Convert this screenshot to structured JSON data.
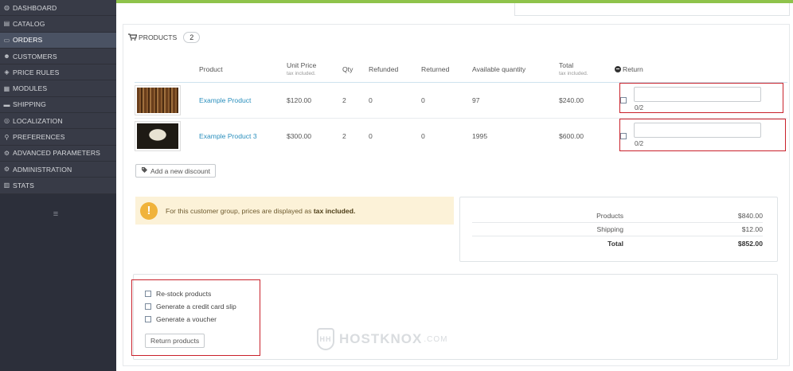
{
  "sidebar": {
    "items": [
      {
        "icon": "dashboard-icon",
        "glyph": "◍",
        "label": "DASHBOARD"
      },
      {
        "icon": "catalog-icon",
        "glyph": "▤",
        "label": "CATALOG"
      },
      {
        "icon": "orders-icon",
        "glyph": "▭",
        "label": "ORDERS"
      },
      {
        "icon": "customers-icon",
        "glyph": "☻",
        "label": "CUSTOMERS"
      },
      {
        "icon": "price-rules-icon",
        "glyph": "◈",
        "label": "PRICE RULES"
      },
      {
        "icon": "modules-icon",
        "glyph": "▦",
        "label": "MODULES"
      },
      {
        "icon": "shipping-icon",
        "glyph": "▬",
        "label": "SHIPPING"
      },
      {
        "icon": "localization-icon",
        "glyph": "◎",
        "label": "LOCALIZATION"
      },
      {
        "icon": "preferences-icon",
        "glyph": "⚲",
        "label": "PREFERENCES"
      },
      {
        "icon": "advanced-parameters-icon",
        "glyph": "⚙",
        "label": "ADVANCED PARAMETERS"
      },
      {
        "icon": "administration-icon",
        "glyph": "⚙",
        "label": "ADMINISTRATION"
      },
      {
        "icon": "stats-icon",
        "glyph": "▥",
        "label": "STATS"
      }
    ],
    "active_item": "ORDERS",
    "collapse_glyph": "≡"
  },
  "products_panel": {
    "title": "PRODUCTS",
    "count": "2",
    "columns": {
      "product": "Product",
      "unit_price": "Unit Price",
      "unit_price_sub": "tax included.",
      "qty": "Qty",
      "refunded": "Refunded",
      "returned": "Returned",
      "available": "Available quantity",
      "total": "Total",
      "total_sub": "tax included.",
      "return": "Return"
    },
    "rows": [
      {
        "name": "Example Product",
        "unit_price": "$120.00",
        "qty": "2",
        "refunded": "0",
        "returned": "0",
        "available": "97",
        "total": "$240.00",
        "return_count": "0/2",
        "return_value": ""
      },
      {
        "name": "Example Product 3",
        "unit_price": "$300.00",
        "qty": "2",
        "refunded": "0",
        "returned": "0",
        "available": "1995",
        "total": "$600.00",
        "return_count": "0/2",
        "return_value": ""
      }
    ],
    "add_discount_label": "Add a new discount"
  },
  "notice": {
    "text": "For this customer group, prices are displayed as",
    "bold": "tax included."
  },
  "totals": {
    "products_label": "Products",
    "products_value": "$840.00",
    "shipping_label": "Shipping",
    "shipping_value": "$12.00",
    "total_label": "Total",
    "total_value": "$852.00"
  },
  "return_options": {
    "restock": "Re-stock products",
    "credit_slip": "Generate a credit card slip",
    "voucher": "Generate a voucher",
    "button": "Return products"
  },
  "watermark": {
    "logo": "HH",
    "text": "HOSTKNOX",
    "suffix": ".COM"
  },
  "colors": {
    "accent_green": "#8fc34b",
    "highlight_red": "#c9212b",
    "link_blue": "#2a8fbd",
    "warning": "#f0b33c"
  }
}
